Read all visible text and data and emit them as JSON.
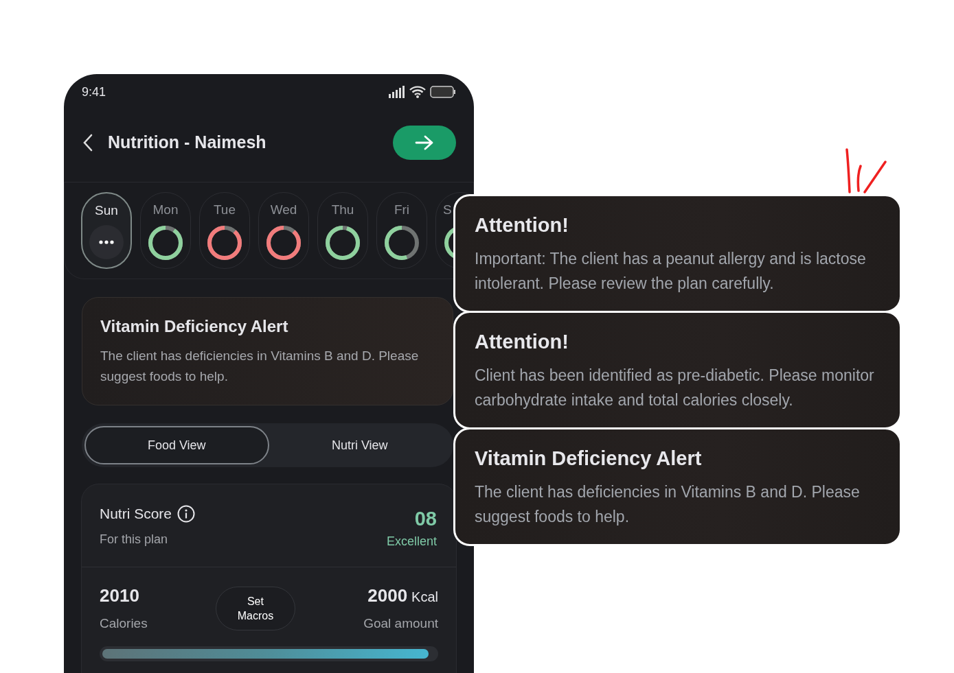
{
  "status_bar": {
    "time": "9:41"
  },
  "header": {
    "title": "Nutrition - Naimesh"
  },
  "days": [
    {
      "label": "Sun",
      "selected": true,
      "kind": "menu"
    },
    {
      "label": "Mon",
      "selected": false,
      "kind": "ring",
      "level": 0.9,
      "color": "#8fd19e"
    },
    {
      "label": "Tue",
      "selected": false,
      "kind": "ring",
      "level": 0.88,
      "color": "#f27c7c"
    },
    {
      "label": "Wed",
      "selected": false,
      "kind": "ring",
      "level": 0.88,
      "color": "#f27c7c"
    },
    {
      "label": "Thu",
      "selected": false,
      "kind": "ring",
      "level": 0.95,
      "color": "#8fd19e"
    },
    {
      "label": "Fri",
      "selected": false,
      "kind": "ring",
      "level": 0.55,
      "color": "#8fd19e"
    },
    {
      "label": "S",
      "selected": false,
      "kind": "edge",
      "color": "#8fd19e"
    }
  ],
  "alert": {
    "title": "Vitamin Deficiency Alert",
    "body": "The client has deficiencies in Vitamins B and D. Please suggest foods to help."
  },
  "view_tabs": [
    {
      "label": "Food View",
      "selected": true
    },
    {
      "label": "Nutri View",
      "selected": false
    }
  ],
  "nutri_score": {
    "title": "Nutri Score",
    "subtitle": "For this plan",
    "score": "08",
    "rating": "Excellent"
  },
  "calories": {
    "value": "2010",
    "label": "Calories",
    "button": "Set Macros",
    "goal": "2000",
    "unit": "Kcal",
    "goal_label": "Goal amount",
    "level": 0.98
  },
  "popups": [
    {
      "title": "Attention!",
      "body": "Important: The client has a peanut allergy and is lactose intolerant. Please review the plan carefully."
    },
    {
      "title": "Attention!",
      "body": "Client has been identified as pre-diabetic. Please monitor carbohydrate intake and total calories closely."
    },
    {
      "title": "Vitamin Deficiency Alert",
      "body": "The client has deficiencies in Vitamins B and D. Please suggest foods to help."
    }
  ]
}
